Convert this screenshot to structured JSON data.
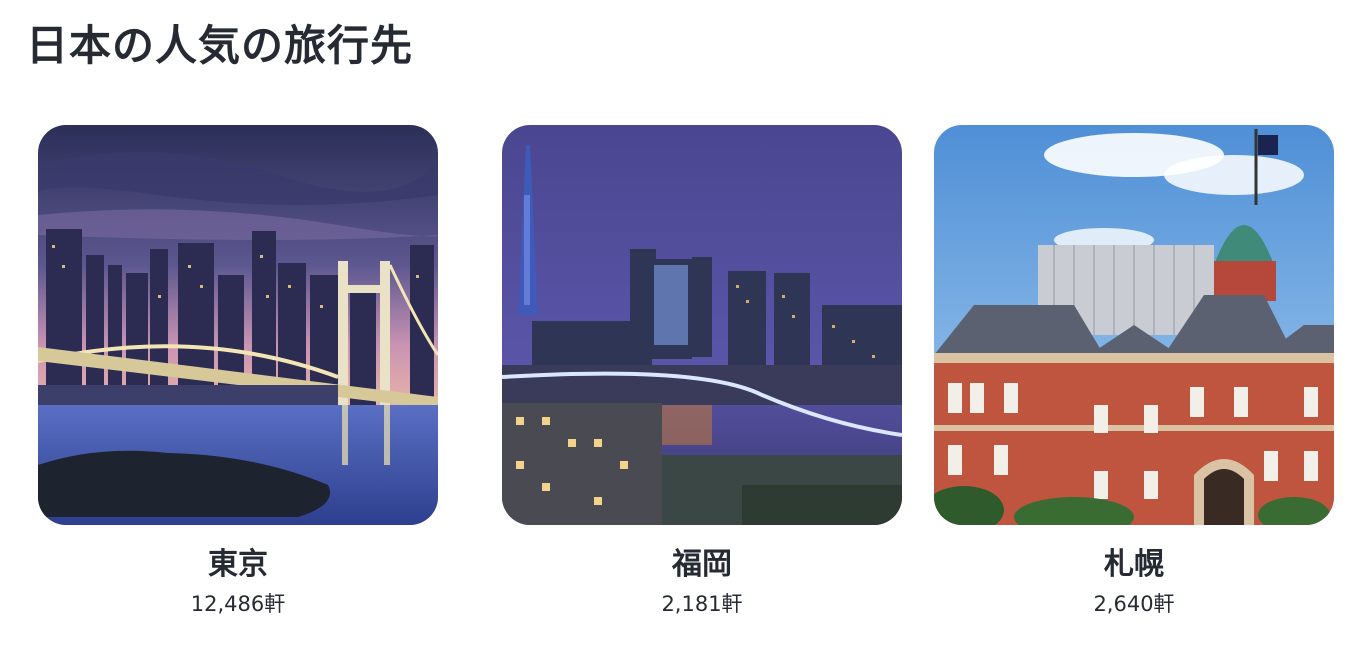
{
  "section": {
    "title": "日本の人気の旅行先"
  },
  "destinations": [
    {
      "name": "東京",
      "count": "12,486軒"
    },
    {
      "name": "福岡",
      "count": "2,181軒"
    },
    {
      "name": "札幌",
      "count": "2,640軒"
    }
  ],
  "colors": {
    "text": "#262b33",
    "tokyo_sky": "#4a4a86",
    "fukuoka_sky": "#56509e",
    "sapporo_sky": "#6aa8e0",
    "brick": "#c0553f",
    "dome": "#3f8a78"
  }
}
